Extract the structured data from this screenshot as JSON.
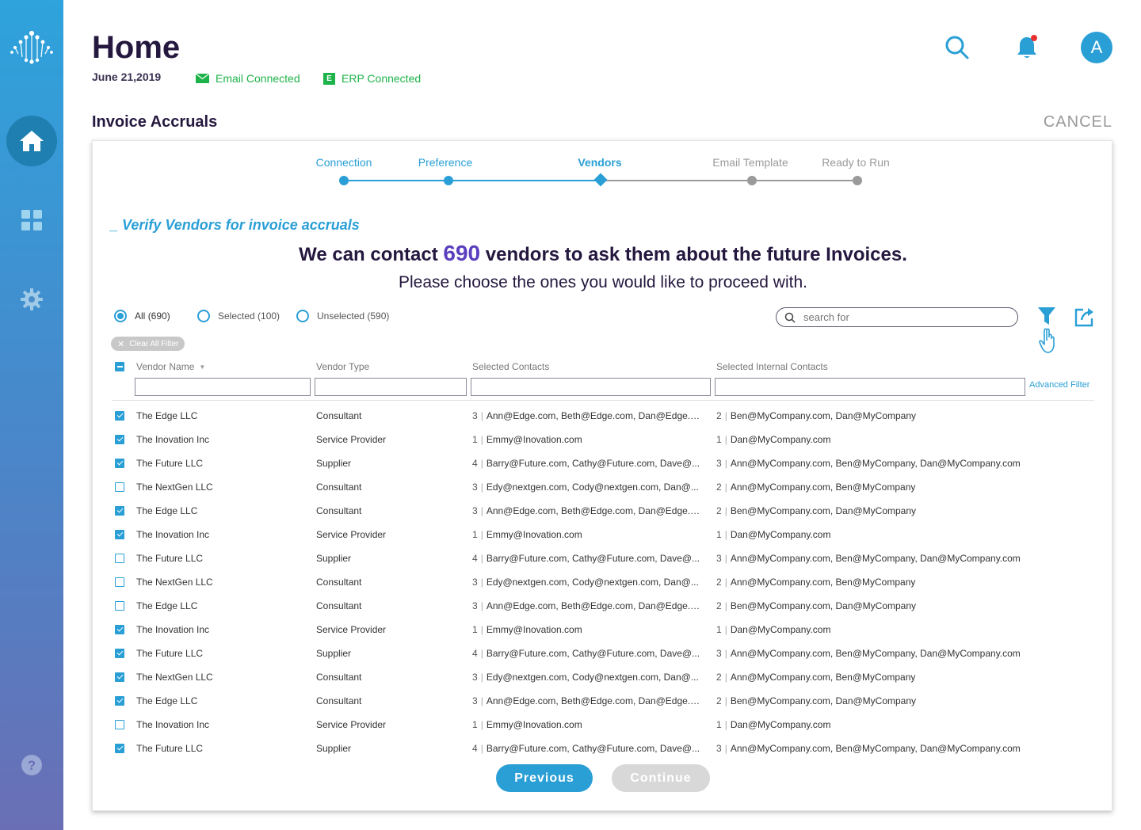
{
  "header": {
    "title": "Home",
    "date": "June 21,2019",
    "email_status": "Email Connected",
    "erp_status": "ERP Connected",
    "erp_badge": "E",
    "avatar_initial": "A"
  },
  "section": {
    "title": "Invoice Accruals",
    "cancel_label": "CANCEL"
  },
  "stepper": {
    "steps": [
      "Connection",
      "Preference",
      "Vendors",
      "Email Template",
      "Ready to Run"
    ],
    "current": 2
  },
  "intro": {
    "verify_title": "_ Verify Vendors for invoice accruals",
    "headline_pre": "We can contact ",
    "headline_count": "690",
    "headline_post": " vendors to ask them about the future Invoices.",
    "subline": "Please choose the ones you would like to proceed with."
  },
  "filters": {
    "all_label": "All",
    "all_count": "(690)",
    "selected_label": "Selected (100)",
    "unselected_label": "Unselected (590)",
    "search_placeholder": "search for",
    "clear_all": "Clear All Filter",
    "advanced": "Advanced Filter"
  },
  "table": {
    "columns": [
      "Vendor Name",
      "Vendor Type",
      "Selected Contacts",
      "Selected Internal Contacts"
    ],
    "rows": [
      {
        "checked": true,
        "name": "The  Edge LLC",
        "type": "Consultant",
        "contact_count": "3",
        "contacts": "Ann@Edge.com, Beth@Edge.com, Dan@Edge.c...",
        "internal_count": "2",
        "internal": "Ben@MyCompany.com, Dan@MyCompany"
      },
      {
        "checked": true,
        "name": "The Inovation Inc",
        "type": "Service Provider",
        "contact_count": "1",
        "contacts": "Emmy@Inovation.com",
        "internal_count": "1",
        "internal": "Dan@MyCompany.com"
      },
      {
        "checked": true,
        "name": "The Future LLC",
        "type": "Supplier",
        "contact_count": "4",
        "contacts": "Barry@Future.com, Cathy@Future.com, Dave@...",
        "internal_count": "3",
        "internal": "Ann@MyCompany.com, Ben@MyCompany, Dan@MyCompany.com"
      },
      {
        "checked": false,
        "name": "The NextGen LLC",
        "type": "Consultant",
        "contact_count": "3",
        "contacts": "Edy@nextgen.com, Cody@nextgen.com, Dan@...",
        "internal_count": "2",
        "internal": "Ann@MyCompany.com, Ben@MyCompany"
      },
      {
        "checked": true,
        "name": "The  Edge LLC",
        "type": "Consultant",
        "contact_count": "3",
        "contacts": "Ann@Edge.com, Beth@Edge.com, Dan@Edge.c...",
        "internal_count": "2",
        "internal": "Ben@MyCompany.com, Dan@MyCompany"
      },
      {
        "checked": true,
        "name": "The Inovation Inc",
        "type": "Service Provider",
        "contact_count": "1",
        "contacts": "Emmy@Inovation.com",
        "internal_count": "1",
        "internal": "Dan@MyCompany.com"
      },
      {
        "checked": false,
        "name": "The Future LLC",
        "type": "Supplier",
        "contact_count": "4",
        "contacts": "Barry@Future.com, Cathy@Future.com, Dave@...",
        "internal_count": "3",
        "internal": "Ann@MyCompany.com, Ben@MyCompany, Dan@MyCompany.com"
      },
      {
        "checked": false,
        "name": "The NextGen LLC",
        "type": "Consultant",
        "contact_count": "3",
        "contacts": "Edy@nextgen.com, Cody@nextgen.com, Dan@...",
        "internal_count": "2",
        "internal": "Ann@MyCompany.com, Ben@MyCompany"
      },
      {
        "checked": false,
        "name": "The  Edge LLC",
        "type": "Consultant",
        "contact_count": "3",
        "contacts": "Ann@Edge.com, Beth@Edge.com, Dan@Edge.c...",
        "internal_count": "2",
        "internal": "Ben@MyCompany.com, Dan@MyCompany"
      },
      {
        "checked": true,
        "name": "The Inovation Inc",
        "type": "Service Provider",
        "contact_count": "1",
        "contacts": "Emmy@Inovation.com",
        "internal_count": "1",
        "internal": "Dan@MyCompany.com"
      },
      {
        "checked": true,
        "name": "The Future LLC",
        "type": "Supplier",
        "contact_count": "4",
        "contacts": "Barry@Future.com, Cathy@Future.com, Dave@...",
        "internal_count": "3",
        "internal": "Ann@MyCompany.com, Ben@MyCompany, Dan@MyCompany.com"
      },
      {
        "checked": true,
        "name": "The NextGen LLC",
        "type": "Consultant",
        "contact_count": "3",
        "contacts": "Edy@nextgen.com, Cody@nextgen.com, Dan@...",
        "internal_count": "2",
        "internal": "Ann@MyCompany.com, Ben@MyCompany"
      },
      {
        "checked": true,
        "name": "The  Edge LLC",
        "type": "Consultant",
        "contact_count": "3",
        "contacts": "Ann@Edge.com, Beth@Edge.com, Dan@Edge.c...",
        "internal_count": "2",
        "internal": "Ben@MyCompany.com, Dan@MyCompany"
      },
      {
        "checked": false,
        "name": "The Inovation Inc",
        "type": "Service Provider",
        "contact_count": "1",
        "contacts": "Emmy@Inovation.com",
        "internal_count": "1",
        "internal": "Dan@MyCompany.com"
      },
      {
        "checked": true,
        "name": "The Future LLC",
        "type": "Supplier",
        "contact_count": "4",
        "contacts": "Barry@Future.com, Cathy@Future.com, Dave@...",
        "internal_count": "3",
        "internal": "Ann@MyCompany.com, Ben@MyCompany, Dan@MyCompany.com"
      }
    ]
  },
  "actions": {
    "previous": "Previous",
    "continue": "Continue"
  },
  "colors": {
    "accent": "#2a9fd6",
    "success": "#1eb34a",
    "alert": "#e8312f",
    "count": "#5b3fbf",
    "disabled": "#d8d8d8"
  }
}
